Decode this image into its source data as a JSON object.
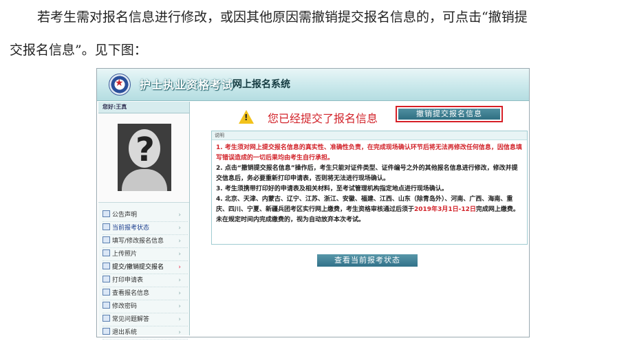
{
  "paragraph": {
    "line1": "若考生需对报名信息进行修改，或因其他原因需撤销提交报名信息的，可点击“撤销提",
    "line2": "交报名信息”。见下图："
  },
  "banner": {
    "title": "护士执业资格考试",
    "subtitle": "网上报名系统"
  },
  "sidebar": {
    "greeting": "您好:王真",
    "items": [
      {
        "label": "公告声明",
        "icon": "home-icon"
      },
      {
        "label": "当前报考状态",
        "icon": "list-icon"
      },
      {
        "label": "填写/修改报名信息",
        "icon": "edit-icon"
      },
      {
        "label": "上传照片",
        "icon": "upload-icon"
      },
      {
        "label": "提交/撤销提交报名",
        "icon": "document-icon"
      },
      {
        "label": "打印申请表",
        "icon": "print-icon"
      },
      {
        "label": "查看报名信息",
        "icon": "view-icon"
      },
      {
        "label": "修改密码",
        "icon": "key-icon"
      },
      {
        "label": "常见问题解答",
        "icon": "help-icon"
      },
      {
        "label": "退出系统",
        "icon": "exit-icon"
      }
    ]
  },
  "main": {
    "submitted_text": "您已经提交了报名信息",
    "withdraw_button": "撤销提交报名信息",
    "notice_header": "说明",
    "notice": [
      {
        "text": "1. 考生须对网上提交报名信息的真实性、准确性负责，在完成现场确认环节后将无法再修改任何信息，因信息填写错误造成的一切后果均由考生自行承担。",
        "color": "#d2232a"
      },
      {
        "text": "2. 点击“撤销提交报名信息”操作后，考生只能对证件类型、证件编号之外的其他报名信息进行修改，修改并提交信息后，务必要重新打印申请表，否则将无法进行现场确认。",
        "color": "#222222"
      },
      {
        "text": "3. 考生须携带打印好的申请表及相关材料，至考试管理机构指定地点进行现场确认。",
        "color": "#222222"
      }
    ],
    "notice4_part1": "4. 北京、天津、内蒙古、辽宁、江苏、浙江、安徽、福建、江西、山东（除青岛外）、河南、广西、海南、重庆、四川、宁夏、新疆兵团考区实行网上缴费，考生资格审核通过后须于",
    "notice4_date": "2019年3月1日-12日",
    "notice4_part2": "完成网上缴费。未在规定时间内完成缴费的，视为自动放弃本次考试。",
    "status_button": "查看当前报考状态"
  },
  "colors": {
    "accent_red": "#d2232a",
    "button_teal": "#3a7b8e",
    "banner_teal": "#c9e8eb"
  }
}
